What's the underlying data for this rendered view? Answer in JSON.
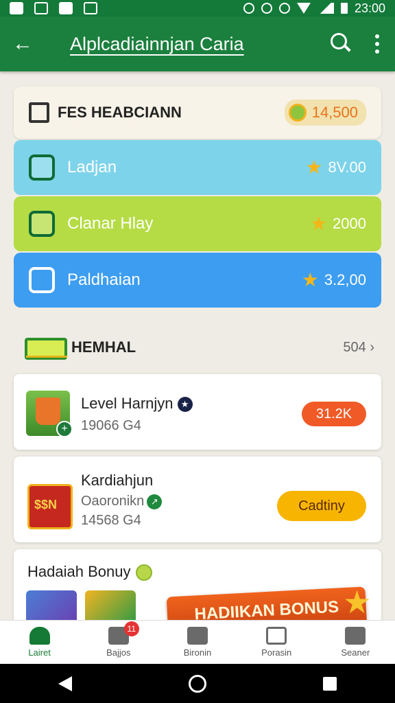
{
  "status_bar": {
    "time": "23:00"
  },
  "app_bar": {
    "title": "Alplcadiainnjan Caria"
  },
  "cards": [
    {
      "label": "FES HEABCIANN",
      "amount": "14,500"
    },
    {
      "label": "Ladjan",
      "amount": "8V.00"
    },
    {
      "label": "Clanar Hlay",
      "amount": "2000"
    },
    {
      "label": "Paldhaian",
      "amount": "3.2,00"
    }
  ],
  "section": {
    "title": "HEMHAL",
    "link": "504 ›"
  },
  "items": [
    {
      "title": "Level Harnjyn",
      "sub": "19066 G4",
      "action": "31.2K"
    },
    {
      "title": "Kardiahjun",
      "sub1": "Oaoronikn",
      "sub2": "14568 G4",
      "action": "Cadtiny"
    },
    {
      "title": "Hadaiah Bonuy",
      "ribbon": "HADIIKAN BONUS"
    }
  ],
  "bottom_nav": [
    {
      "label": "Lairet",
      "badge": ""
    },
    {
      "label": "Bajjos",
      "badge": "11"
    },
    {
      "label": "Bironin",
      "badge": ""
    },
    {
      "label": "Porasin",
      "badge": ""
    },
    {
      "label": "Seaner",
      "badge": ""
    }
  ],
  "colors": {
    "primary": "#1b7f3e",
    "card_blue": "#7dd3ea",
    "card_lime": "#b5dc45",
    "card_azure": "#3d9df0",
    "accent_orange": "#ef5a27",
    "accent_yellow": "#f7b400"
  }
}
